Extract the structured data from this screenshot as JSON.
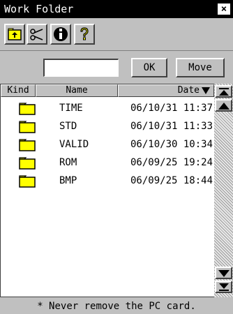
{
  "window": {
    "title": "Work Folder",
    "close_label": "×"
  },
  "toolbar": {
    "buttons": [
      {
        "icon": "folder-up-icon"
      },
      {
        "icon": "scissors-icon"
      },
      {
        "icon": "info-icon"
      },
      {
        "icon": "help-icon"
      }
    ]
  },
  "input_row": {
    "value": "",
    "ok_label": "OK",
    "move_label": "Move"
  },
  "list": {
    "columns": {
      "kind": "Kind",
      "name": "Name",
      "date": "Date",
      "sort_icon": "sort-descending-icon"
    },
    "rows": [
      {
        "name": "TIME",
        "date": "06/10/31 11:37"
      },
      {
        "name": "STD",
        "date": "06/10/31 11:33"
      },
      {
        "name": "VALID",
        "date": "06/10/30 10:34"
      },
      {
        "name": "ROM",
        "date": "06/09/25 19:24"
      },
      {
        "name": "BMP",
        "date": "06/09/25 18:44"
      }
    ]
  },
  "status": {
    "text": "* Never remove the PC card."
  },
  "colors": {
    "folder": "#ffff00",
    "titlebar": "#000000",
    "background": "#c0c0c0"
  }
}
